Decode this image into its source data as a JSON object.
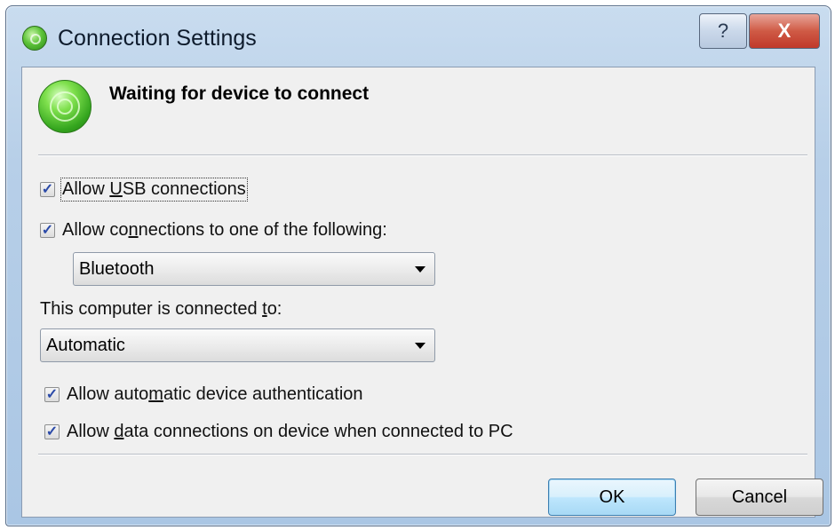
{
  "window": {
    "title": "Connection Settings",
    "help_label": "?",
    "close_label": "X"
  },
  "status": {
    "title": "Waiting for device to connect",
    "icon": "connection-status-icon"
  },
  "options": {
    "allow_usb": {
      "pre": "Allow ",
      "key": "U",
      "post": "SB connections",
      "checked": true
    },
    "allow_following": {
      "pre": "Allow co",
      "key": "n",
      "post": "nections to one of the following:",
      "checked": true
    },
    "connection_type": {
      "selected": "Bluetooth"
    },
    "connected_to_label": {
      "pre": "This computer is connected ",
      "key": "t",
      "post": "o:"
    },
    "connected_to": {
      "selected": "Automatic"
    },
    "allow_auth": {
      "pre": "Allow auto",
      "key": "m",
      "post": "atic device authentication",
      "checked": true
    },
    "allow_data": {
      "pre": "Allow ",
      "key": "d",
      "post": "ata connections on device when connected to PC",
      "checked": true
    }
  },
  "buttons": {
    "ok": "OK",
    "cancel": "Cancel"
  },
  "check_glyph": "✓",
  "colors": {
    "titlebar": "#b7cfe8",
    "client_bg": "#f0f0f0",
    "close_button": "#c0392b",
    "check_mark": "#2b4aa8",
    "default_button_border": "#3c7fb1"
  }
}
